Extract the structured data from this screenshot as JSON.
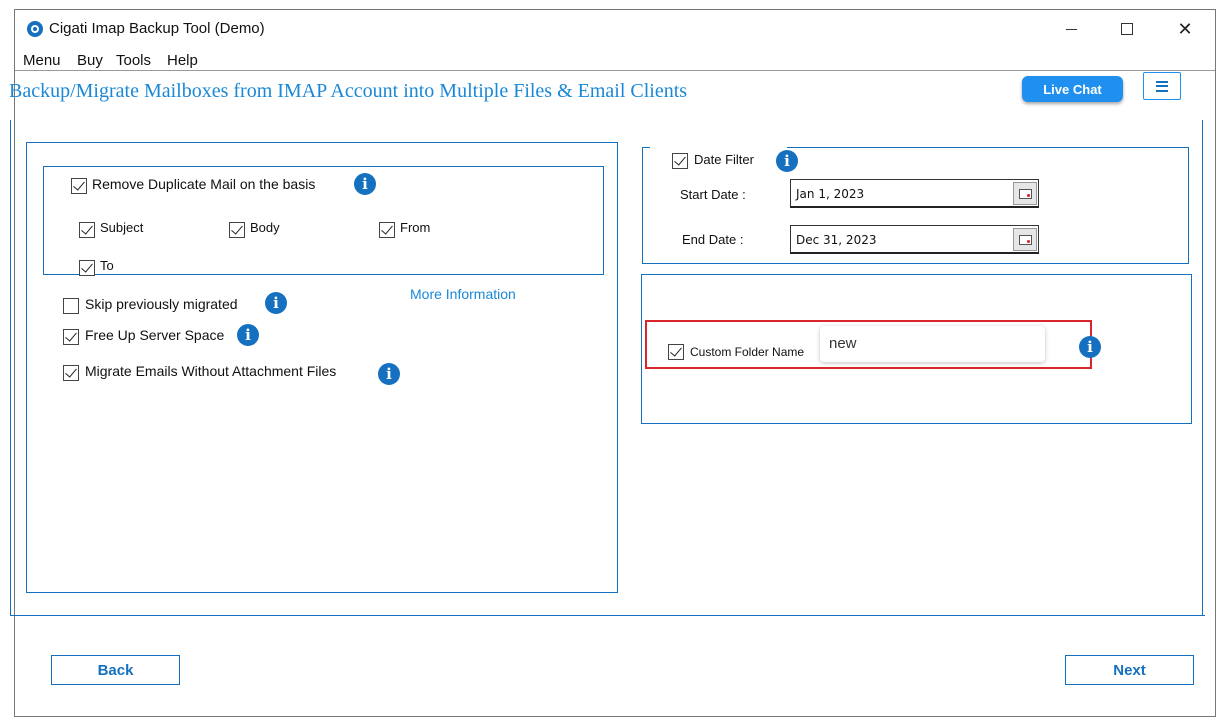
{
  "window": {
    "title": "Cigati Imap Backup Tool (Demo)"
  },
  "menu": {
    "items": [
      "Menu",
      "Buy",
      "Tools",
      "Help"
    ]
  },
  "header": {
    "title": "Backup/Migrate Mailboxes from IMAP Account into Multiple Files & Email Clients",
    "live_chat_label": "Live Chat"
  },
  "left_panel": {
    "remove_duplicate": {
      "label": "Remove Duplicate Mail on the basis",
      "checked": true
    },
    "criteria": [
      {
        "label": "Subject",
        "checked": true
      },
      {
        "label": "Body",
        "checked": true
      },
      {
        "label": "From",
        "checked": true
      },
      {
        "label": "To",
        "checked": true
      }
    ],
    "skip_previously_migrated": {
      "label": "Skip previously migrated",
      "checked": false
    },
    "more_information": "More Information",
    "free_up_server_space": {
      "label": "Free Up Server Space",
      "checked": true
    },
    "migrate_without_attachments": {
      "label": "Migrate Emails Without Attachment Files",
      "checked": true
    }
  },
  "date_filter": {
    "label": "Date Filter",
    "checked": true,
    "start_label": "Start Date :",
    "start_value": "Jan 1, 2023",
    "end_label": "End Date :",
    "end_value": "Dec 31, 2023"
  },
  "custom_folder": {
    "label": "Custom Folder Name",
    "checked": true,
    "value": "new"
  },
  "footer": {
    "back_label": "Back",
    "next_label": "Next"
  },
  "colors": {
    "accent": "#1570c0",
    "title": "#1b88d6",
    "highlight": "#d9262c",
    "live_chat_bg": "#1f8ff0"
  },
  "icons": [
    "app-logo-icon",
    "minimize-icon",
    "maximize-icon",
    "close-icon",
    "hamburger-menu-icon",
    "info-icon",
    "calendar-icon",
    "checkbox-icon"
  ]
}
